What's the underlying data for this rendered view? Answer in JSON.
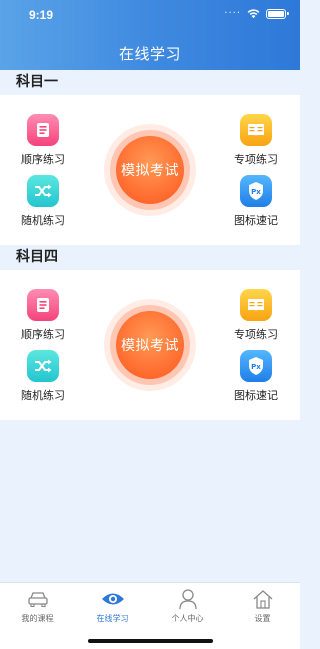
{
  "status_bar": {
    "time": "9:19"
  },
  "header": {
    "title": "在线学习"
  },
  "sections": [
    {
      "label": "科目一",
      "exam_label": "模拟考试",
      "items": [
        {
          "label": "顺序练习",
          "icon": "sequential-practice-icon"
        },
        {
          "label": "专项练习",
          "icon": "special-practice-icon"
        },
        {
          "label": "随机练习",
          "icon": "random-practice-icon"
        },
        {
          "label": "图标速记",
          "icon": "icon-memo-icon"
        }
      ]
    },
    {
      "label": "科目四",
      "exam_label": "模拟考试",
      "items": [
        {
          "label": "顺序练习",
          "icon": "sequential-practice-icon"
        },
        {
          "label": "专项练习",
          "icon": "special-practice-icon"
        },
        {
          "label": "随机练习",
          "icon": "random-practice-icon"
        },
        {
          "label": "图标速记",
          "icon": "icon-memo-icon"
        }
      ]
    }
  ],
  "tabbar": {
    "tabs": [
      {
        "label": "我的课程",
        "icon": "car-icon"
      },
      {
        "label": "在线学习",
        "icon": "eye-icon",
        "active": true
      },
      {
        "label": "个人中心",
        "icon": "person-icon"
      },
      {
        "label": "设置",
        "icon": "home-icon"
      }
    ]
  },
  "colors": {
    "header_gradient": [
      "#5aa3e8",
      "#2e78d8"
    ],
    "exam_button": "#ff6a2e",
    "active_tab": "#2e78d8"
  }
}
